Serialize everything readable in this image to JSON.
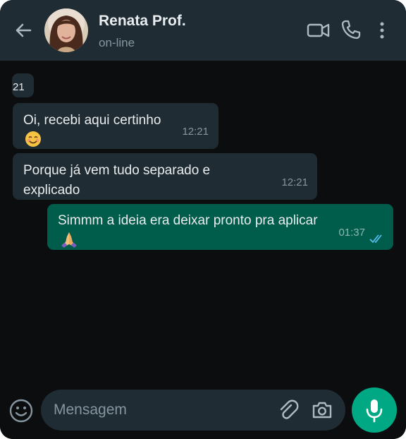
{
  "header": {
    "contact_name": "Renata Prof.",
    "status": "on-line",
    "icons": [
      "back-arrow-icon",
      "video-call-icon",
      "voice-call-icon",
      "more-options-icon"
    ]
  },
  "messages": [
    {
      "direction": "incoming",
      "text": "21",
      "time": ""
    },
    {
      "direction": "incoming",
      "text": "Oi, recebi aqui certinho",
      "emoji": "smiling-face",
      "time": "12:21"
    },
    {
      "direction": "incoming",
      "text": "Porque já vem tudo separado e explicado",
      "time": "12:21"
    },
    {
      "direction": "outgoing",
      "text": "Simmm a ideia era deixar pronto pra aplicar",
      "emoji": "folded-hands",
      "time": "01:37",
      "read": true
    }
  ],
  "composer": {
    "placeholder": "Mensagem",
    "icons": [
      "emoji-icon",
      "attach-icon",
      "camera-icon",
      "microphone-icon"
    ]
  },
  "colors": {
    "header_bg": "#1f2c34",
    "chat_bg": "#0b0d0e",
    "incoming_bubble": "#202c33",
    "outgoing_bubble": "#005c4b",
    "accent": "#00a884",
    "read_ticks": "#53bdeb"
  }
}
